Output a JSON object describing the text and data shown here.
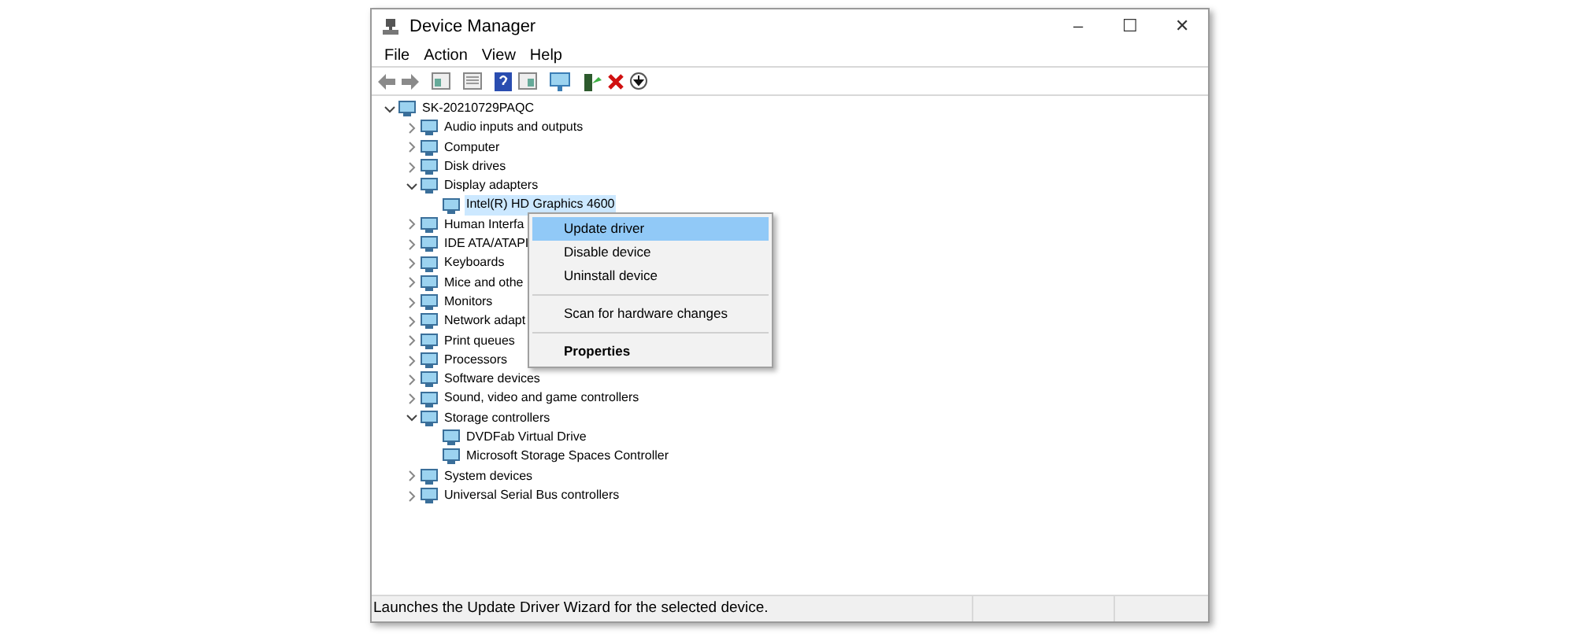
{
  "window": {
    "title": "Device Manager",
    "controls": [
      "–",
      "☐",
      "✕"
    ]
  },
  "menu_bar": [
    "File",
    "Action",
    "View",
    "Help"
  ],
  "tree": [
    {
      "label": "SK-20210729PAQC",
      "expanded": true,
      "selected": false,
      "children": [
        {
          "label": "Audio inputs and outputs",
          "expanded": false,
          "selected": false
        },
        {
          "label": "Computer",
          "expanded": false,
          "selected": false
        },
        {
          "label": "Disk drives",
          "expanded": false,
          "selected": false
        },
        {
          "label": "Display adapters",
          "expanded": true,
          "selected": false,
          "children": [
            {
              "label": "Intel(R) HD Graphics 4600",
              "selected": true
            }
          ]
        },
        {
          "label": "Human Interfa",
          "expanded": false,
          "selected": false
        },
        {
          "label": "IDE ATA/ATAPI",
          "expanded": false,
          "selected": false
        },
        {
          "label": "Keyboards",
          "expanded": false,
          "selected": false
        },
        {
          "label": "Mice and othe",
          "expanded": false,
          "selected": false
        },
        {
          "label": "Monitors",
          "expanded": false,
          "selected": false
        },
        {
          "label": "Network adapt",
          "expanded": false,
          "selected": false
        },
        {
          "label": "Print queues",
          "expanded": false,
          "selected": false
        },
        {
          "label": "Processors",
          "expanded": false,
          "selected": false
        },
        {
          "label": "Software devices",
          "expanded": false,
          "selected": false
        },
        {
          "label": "Sound, video and game controllers",
          "expanded": false,
          "selected": false
        },
        {
          "label": "Storage controllers",
          "expanded": true,
          "selected": false,
          "children": [
            {
              "label": "DVDFab Virtual Drive",
              "selected": false
            },
            {
              "label": "Microsoft Storage Spaces Controller",
              "selected": false
            }
          ]
        },
        {
          "label": "System devices",
          "expanded": false,
          "selected": false
        },
        {
          "label": "Universal Serial Bus controllers",
          "expanded": false,
          "selected": false
        }
      ]
    }
  ],
  "context_menu": [
    {
      "kind": "item",
      "label": "Update driver",
      "selected": true,
      "bold": false
    },
    {
      "kind": "item",
      "label": "Disable device",
      "selected": false,
      "bold": false
    },
    {
      "kind": "item",
      "label": "Uninstall device",
      "selected": false,
      "bold": false
    },
    {
      "kind": "separator"
    },
    {
      "kind": "item",
      "label": "Scan for hardware changes",
      "selected": false,
      "bold": false
    },
    {
      "kind": "separator"
    },
    {
      "kind": "item",
      "label": "Properties",
      "selected": false,
      "bold": true
    }
  ],
  "status_bar": "Launches the Update Driver Wizard for the selected device."
}
